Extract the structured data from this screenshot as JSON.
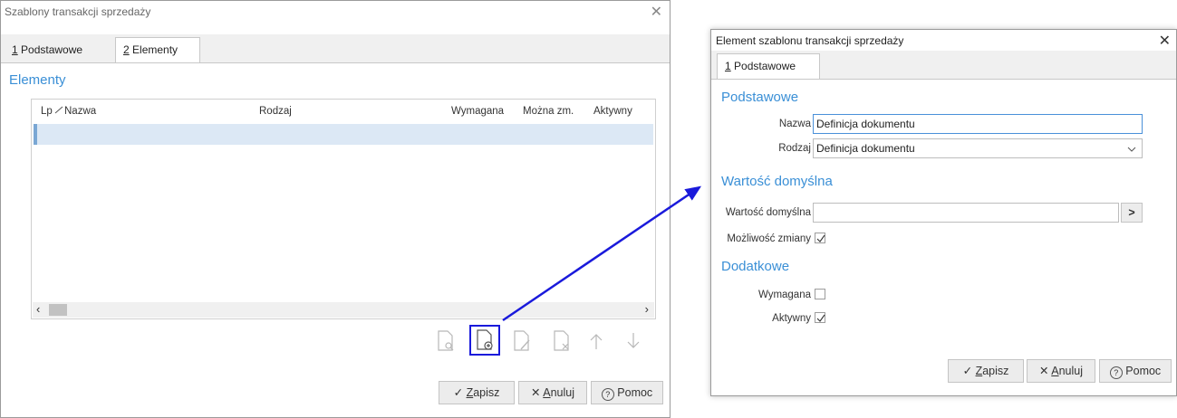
{
  "main_window": {
    "title": "Szablony transakcji sprzedaży",
    "tabs": [
      {
        "accel": "1",
        "rest": " Podstawowe"
      },
      {
        "accel": "2",
        "rest": " Elementy"
      }
    ],
    "section_title": "Elementy",
    "grid": {
      "columns": [
        "Lp",
        "Nazwa",
        "Rodzaj",
        "Wymagana",
        "Można zm.",
        "Aktywny"
      ]
    },
    "toolbar_icons": [
      "view-document-icon",
      "add-document-icon",
      "edit-document-icon",
      "delete-document-icon",
      "arrow-up-icon",
      "arrow-down-icon"
    ],
    "buttons": {
      "save": {
        "icon": "✓",
        "accel": "Z",
        "rest": "apisz"
      },
      "cancel": {
        "icon": "✕",
        "accel": "A",
        "rest": "nuluj"
      },
      "help": {
        "icon": "?",
        "label": "Pomoc"
      }
    }
  },
  "detail_window": {
    "title": "Element szablonu transakcji sprzedaży",
    "tabs": [
      {
        "accel": "1",
        "rest": " Podstawowe"
      }
    ],
    "sections": {
      "basic": "Podstawowe",
      "default_value": "Wartość domyślna",
      "additional": "Dodatkowe"
    },
    "fields": {
      "name_label": "Nazwa",
      "name_value": "Definicja dokumentu",
      "type_label": "Rodzaj",
      "type_value": "Definicja dokumentu",
      "default_label": "Wartość domyślna",
      "default_value": "",
      "default_button": ">",
      "changeable_label": "Możliwość zmiany",
      "changeable_checked": true,
      "required_label": "Wymagana",
      "required_checked": false,
      "active_label": "Aktywny",
      "active_checked": true
    },
    "buttons": {
      "save": {
        "icon": "✓",
        "accel": "Z",
        "rest": "apisz"
      },
      "cancel": {
        "icon": "✕",
        "accel": "A",
        "rest": "nuluj"
      },
      "help": {
        "icon": "?",
        "label": "Pomoc"
      }
    }
  },
  "colors": {
    "accent": "#3a8fd6",
    "highlight_box": "#1a1adb",
    "arrow": "#1a1adb",
    "selected_row": "#dce8f5"
  }
}
